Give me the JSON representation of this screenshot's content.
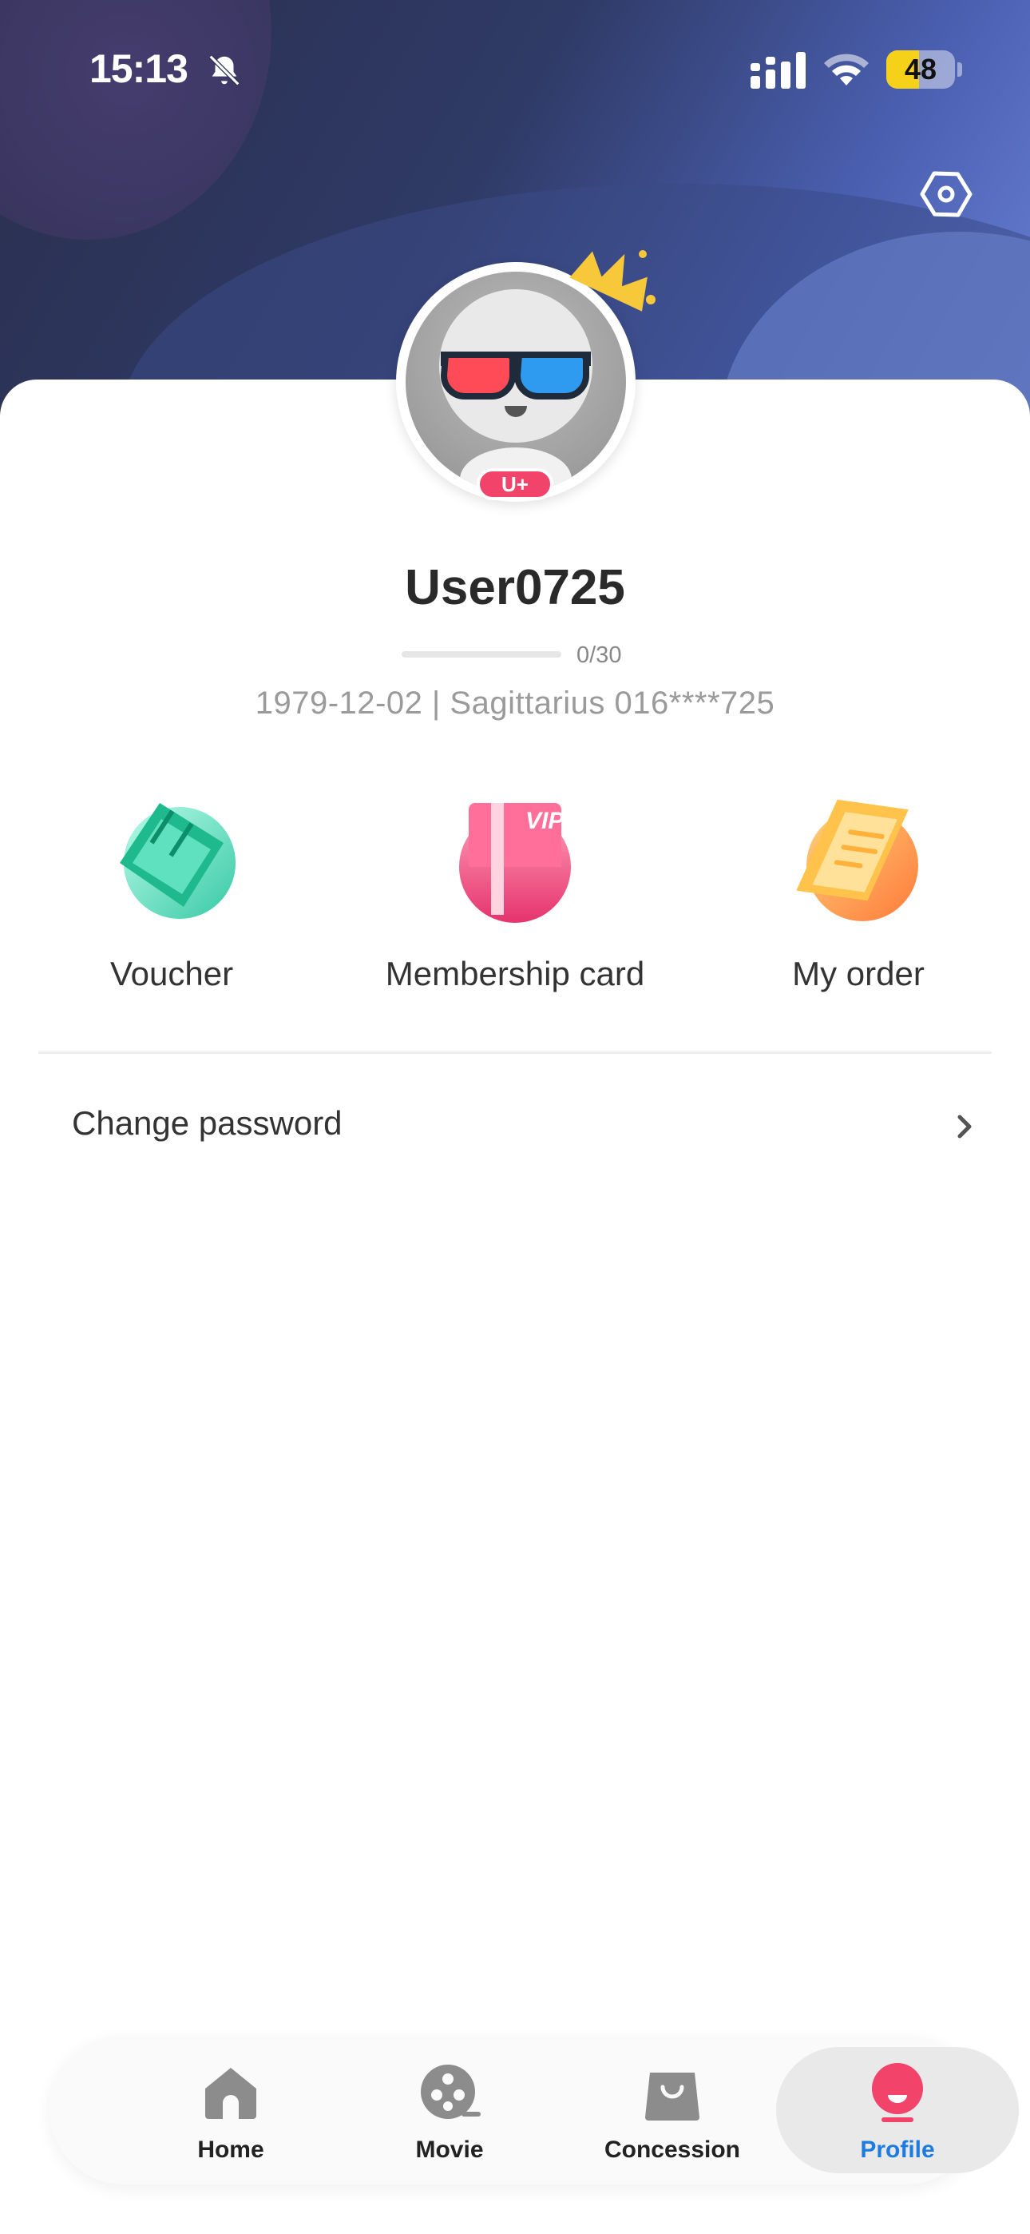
{
  "status_bar": {
    "time": "15:13",
    "battery_level": "48",
    "battery_fraction": 0.48,
    "icons": [
      "bell-muted-icon",
      "cellular-signal-icon",
      "wifi-icon",
      "battery-icon"
    ]
  },
  "header": {
    "settings_icon": "hexagon-gear-icon"
  },
  "profile": {
    "username": "User0725",
    "badge": "U+",
    "progress_text": "0/30",
    "progress_fraction": 0,
    "info_line": "1979-12-02 | Sagittarius  016****725"
  },
  "actions": [
    {
      "label": "Voucher",
      "icon": "ticket-icon"
    },
    {
      "label": "Membership card",
      "icon": "vip-card-icon"
    },
    {
      "label": "My order",
      "icon": "clipboard-order-icon"
    }
  ],
  "settings_list": [
    {
      "label": "Change password",
      "icon": "chevron-right-icon"
    }
  ],
  "tabs": [
    {
      "label": "Home",
      "icon": "home-icon"
    },
    {
      "label": "Movie",
      "icon": "film-reel-icon"
    },
    {
      "label": "Concession",
      "icon": "shopping-bag-icon"
    },
    {
      "label": "Profile",
      "icon": "profile-icon",
      "active": true
    }
  ],
  "colors": {
    "accent": "#1e7be0",
    "brand_pink": "#f2436b",
    "header_dark": "#2a2f4f",
    "header_light": "#6b82d6"
  }
}
